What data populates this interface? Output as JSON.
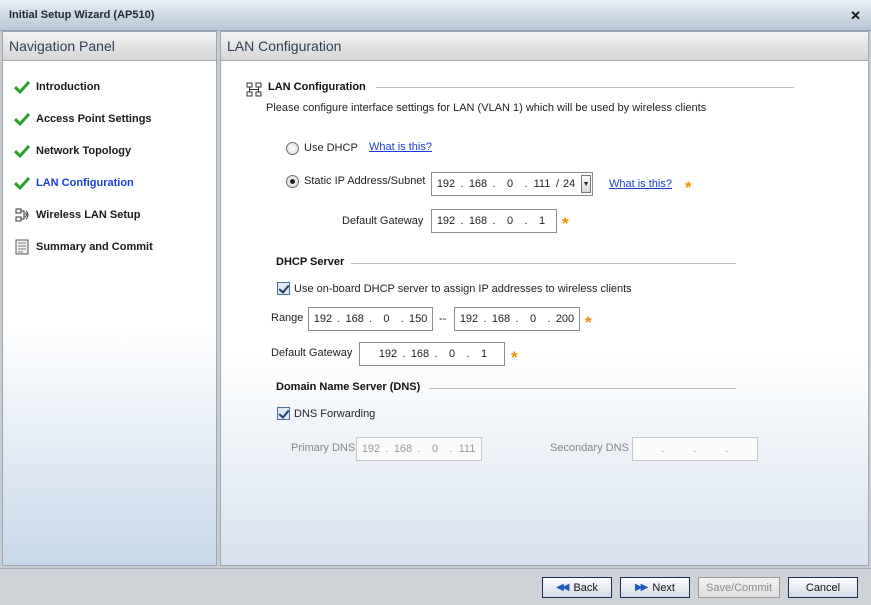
{
  "window": {
    "title": "Initial Setup Wizard (AP510)",
    "close_glyph": "✕"
  },
  "nav": {
    "header": "Navigation Panel",
    "items": [
      {
        "label": "Introduction",
        "icon": "check-icon",
        "active": false
      },
      {
        "label": "Access Point Settings",
        "icon": "check-icon",
        "active": false
      },
      {
        "label": "Network Topology",
        "icon": "check-icon",
        "active": false
      },
      {
        "label": "LAN Configuration",
        "icon": "check-icon",
        "active": true
      },
      {
        "label": "Wireless LAN Setup",
        "icon": "wireless-network-icon",
        "active": false
      },
      {
        "label": "Summary and Commit",
        "icon": "document-icon",
        "active": false
      }
    ]
  },
  "main": {
    "header": "LAN Configuration",
    "lan": {
      "title": "LAN Configuration",
      "description": "Please configure interface settings for LAN (VLAN 1) which will be used by wireless clients",
      "use_dhcp_label": "Use DHCP",
      "static_ip_label": "Static IP Address/Subnet",
      "what_is_this": "What is this?",
      "static_ip": {
        "o1": "192",
        "o2": "168",
        "o3": "0",
        "o4": "111",
        "sep": "/",
        "mask": "24"
      },
      "gateway_label": "Default Gateway",
      "gateway": {
        "o1": "192",
        "o2": "168",
        "o3": "0",
        "o4": "1"
      }
    },
    "dhcp": {
      "title": "DHCP Server",
      "checkbox_label": "Use on-board DHCP server to assign IP addresses to wireless clients",
      "range_label": "Range",
      "range_sep": "--",
      "range_start": {
        "o1": "192",
        "o2": "168",
        "o3": "0",
        "o4": "150"
      },
      "range_end": {
        "o1": "192",
        "o2": "168",
        "o3": "0",
        "o4": "200"
      },
      "gateway_label": "Default Gateway",
      "gateway": {
        "o1": "192",
        "o2": "168",
        "o3": "0",
        "o4": "1"
      }
    },
    "dns": {
      "title": "Domain Name Server (DNS)",
      "forwarding_label": "DNS Forwarding",
      "primary_label": "Primary DNS",
      "primary": {
        "o1": "192",
        "o2": "168",
        "o3": "0",
        "o4": "111"
      },
      "secondary_label": "Secondary DNS"
    },
    "required_mark": "*"
  },
  "footer": {
    "back": "Back",
    "next": "Next",
    "save_commit": "Save/Commit",
    "cancel": "Cancel"
  },
  "colors": {
    "accent_link": "#1a3fd6",
    "required": "#f08c00",
    "check": "#2aa52a"
  }
}
